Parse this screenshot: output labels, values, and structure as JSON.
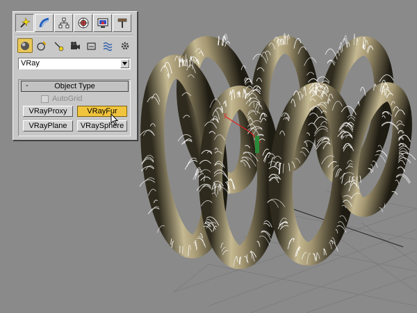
{
  "command_panel": {
    "tabs": [
      {
        "icon": "create-tab-icon",
        "active": true
      },
      {
        "icon": "modify-tab-icon",
        "active": false
      },
      {
        "icon": "hierarchy-tab-icon",
        "active": false
      },
      {
        "icon": "motion-tab-icon",
        "active": false
      },
      {
        "icon": "display-tab-icon",
        "active": false
      },
      {
        "icon": "utilities-tab-icon",
        "active": false
      }
    ],
    "categories": [
      {
        "icon": "geometry-icon",
        "active": true
      },
      {
        "icon": "shapes-icon",
        "active": false
      },
      {
        "icon": "lights-icon",
        "active": false
      },
      {
        "icon": "cameras-icon",
        "active": false
      },
      {
        "icon": "helpers-icon",
        "active": false
      },
      {
        "icon": "space-warps-icon",
        "active": false
      },
      {
        "icon": "systems-icon",
        "active": false
      }
    ],
    "dropdown_value": "VRay",
    "rollout": {
      "collapse_symbol": "-",
      "title": "Object Type",
      "autogrid_label": "AutoGrid",
      "buttons": {
        "vrayproxy": "VRayProxy",
        "vrayfur": "VRayFur",
        "vrayplane": "VRayPlane",
        "vraysphere": "VRaySphere"
      },
      "active_button": "VRayFur"
    }
  },
  "colors": {
    "viewport_bg": "#8a8a8a",
    "torus": "#b9ad86",
    "fur": "#ffffff",
    "active_button": "#f0c43c"
  }
}
